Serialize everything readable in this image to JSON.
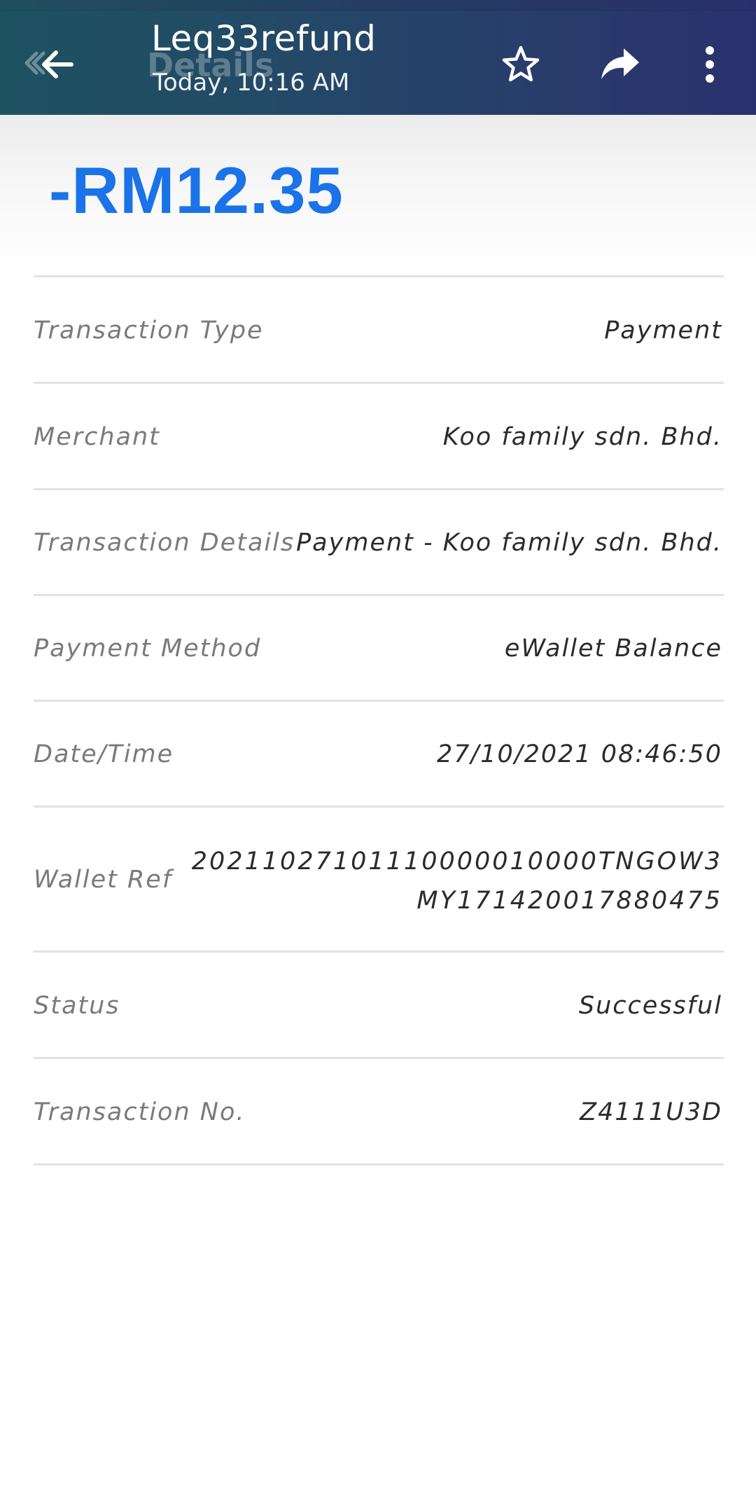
{
  "header": {
    "title": "Leq33refund",
    "subtitle": "Today, 10:16 AM",
    "background_title": "Details",
    "icons": {
      "back": "arrow-left-icon",
      "star": "star-outline-icon",
      "share": "share-forward-icon",
      "more": "more-vertical-icon"
    }
  },
  "amount": {
    "value": "-RM12.35",
    "color": "#1a73e8"
  },
  "details": [
    {
      "label": "Transaction Type",
      "value": "Payment"
    },
    {
      "label": "Merchant",
      "value": "Koo family sdn. Bhd."
    },
    {
      "label": "Transaction Details",
      "value": "Payment - Koo family sdn. Bhd."
    },
    {
      "label": "Payment Method",
      "value": "eWallet Balance"
    },
    {
      "label": "Date/Time",
      "value": "27/10/2021 08:46:50"
    },
    {
      "label": "Wallet Ref",
      "value": "20211027101110000010000TNGOW3MY171420017880475"
    },
    {
      "label": "Status",
      "value": "Successful"
    },
    {
      "label": "Transaction No.",
      "value": "Z4111U3D"
    }
  ]
}
